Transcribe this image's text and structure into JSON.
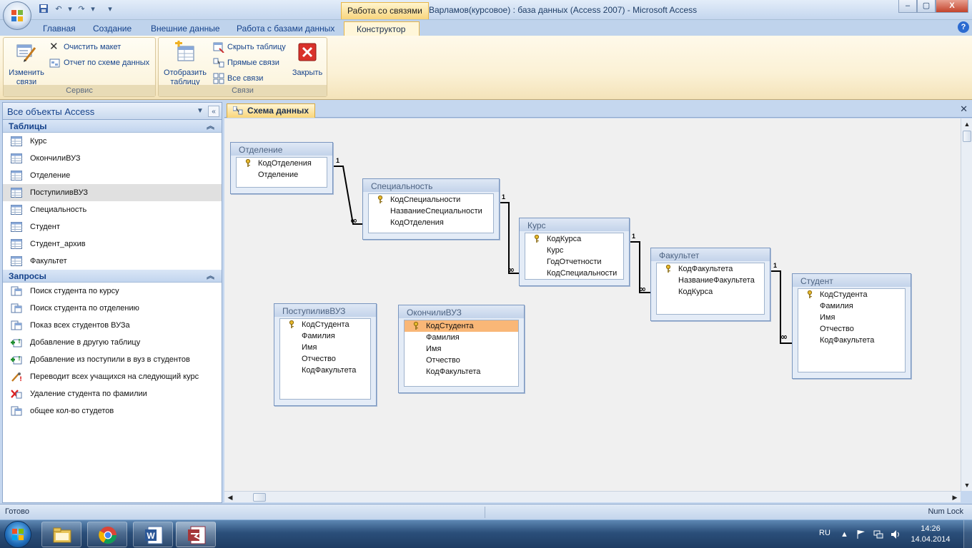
{
  "window": {
    "context_tab": "Работа со связями",
    "title": "Варламов(курсовое) : база данных (Access 2007) - Microsoft Access",
    "minimize": "–",
    "maximize": "▢",
    "close": "X"
  },
  "ribbon": {
    "tabs": [
      "Главная",
      "Создание",
      "Внешние данные",
      "Работа с базами данных",
      "Конструктор"
    ],
    "active_tab": "Конструктор",
    "help": "?",
    "groups": {
      "service": {
        "label": "Сервис",
        "edit_relations": "Изменить связи",
        "clear_layout": "Очистить макет",
        "report": "Отчет по схеме данных"
      },
      "relations": {
        "label": "Связи",
        "show_table": "Отобразить таблицу",
        "hide_table": "Скрыть таблицу",
        "direct_relations": "Прямые связи",
        "all_relations": "Все связи",
        "close": "Закрыть"
      }
    }
  },
  "nav": {
    "header": "Все объекты Access",
    "tables_group": "Таблицы",
    "tables": [
      "Курс",
      "ОкончилиВУЗ",
      "Отделение",
      "ПоступиливВУЗ",
      "Специальность",
      "Студент",
      "Студент_архив",
      "Факультет"
    ],
    "selected_table": "ПоступиливВУЗ",
    "queries_group": "Запросы",
    "queries": [
      {
        "label": "Поиск студента по курсу",
        "icon": "select-query-icon"
      },
      {
        "label": "Поиск студента по отделению",
        "icon": "select-query-icon"
      },
      {
        "label": "Показ всех студентов ВУЗа",
        "icon": "select-query-icon"
      },
      {
        "label": "Добавление в другую таблицу",
        "icon": "append-query-icon"
      },
      {
        "label": "Добавление из поступили в вуз в студентов",
        "icon": "append-query-icon"
      },
      {
        "label": "Переводит всех учащихся на следующий курс",
        "icon": "update-query-icon"
      },
      {
        "label": "Удаление студента по фамилии",
        "icon": "delete-query-icon"
      },
      {
        "label": "общее кол-во студетов",
        "icon": "select-query-icon"
      }
    ]
  },
  "document": {
    "tab": "Схема данных",
    "close": "✕"
  },
  "relationships": {
    "tables": {
      "otdelenie": {
        "title": "Отделение",
        "fields": [
          "КодОтделения",
          "Отделение"
        ],
        "keys": [
          0
        ]
      },
      "specialnost": {
        "title": "Специальность",
        "fields": [
          "КодСпециальности",
          "НазваниеСпециальности",
          "КодОтделения"
        ],
        "keys": [
          0
        ]
      },
      "kurs": {
        "title": "Курс",
        "fields": [
          "КодКурса",
          "Курс",
          "ГодОтчетности",
          "КодСпециальности"
        ],
        "keys": [
          0
        ]
      },
      "fakultet": {
        "title": "Факультет",
        "fields": [
          "КодФакультета",
          "НазваниеФакультета",
          "КодКурса"
        ],
        "keys": [
          0
        ]
      },
      "student": {
        "title": "Студент",
        "fields": [
          "КодСтудента",
          "Фамилия",
          "Имя",
          "Отчество",
          "КодФакультета"
        ],
        "keys": [
          0
        ]
      },
      "postupili": {
        "title": "ПоступиливВУЗ",
        "fields": [
          "КодСтудента",
          "Фамилия",
          "Имя",
          "Отчество",
          "КодФакультета"
        ],
        "keys": [
          0
        ]
      },
      "okonchili": {
        "title": "ОкончилиВУЗ",
        "fields": [
          "КодСтудента",
          "Фамилия",
          "Имя",
          "Отчество",
          "КодФакультета"
        ],
        "keys": [
          0
        ],
        "selected_field": 0
      }
    },
    "one_label": "1",
    "many_label": "∞"
  },
  "status": {
    "left": "Готово",
    "right": "Num Lock"
  },
  "taskbar": {
    "apps": [
      "explorer-icon",
      "chrome-icon",
      "word-icon",
      "access-icon"
    ],
    "language": "RU",
    "time": "14:26",
    "date": "14.04.2014"
  }
}
